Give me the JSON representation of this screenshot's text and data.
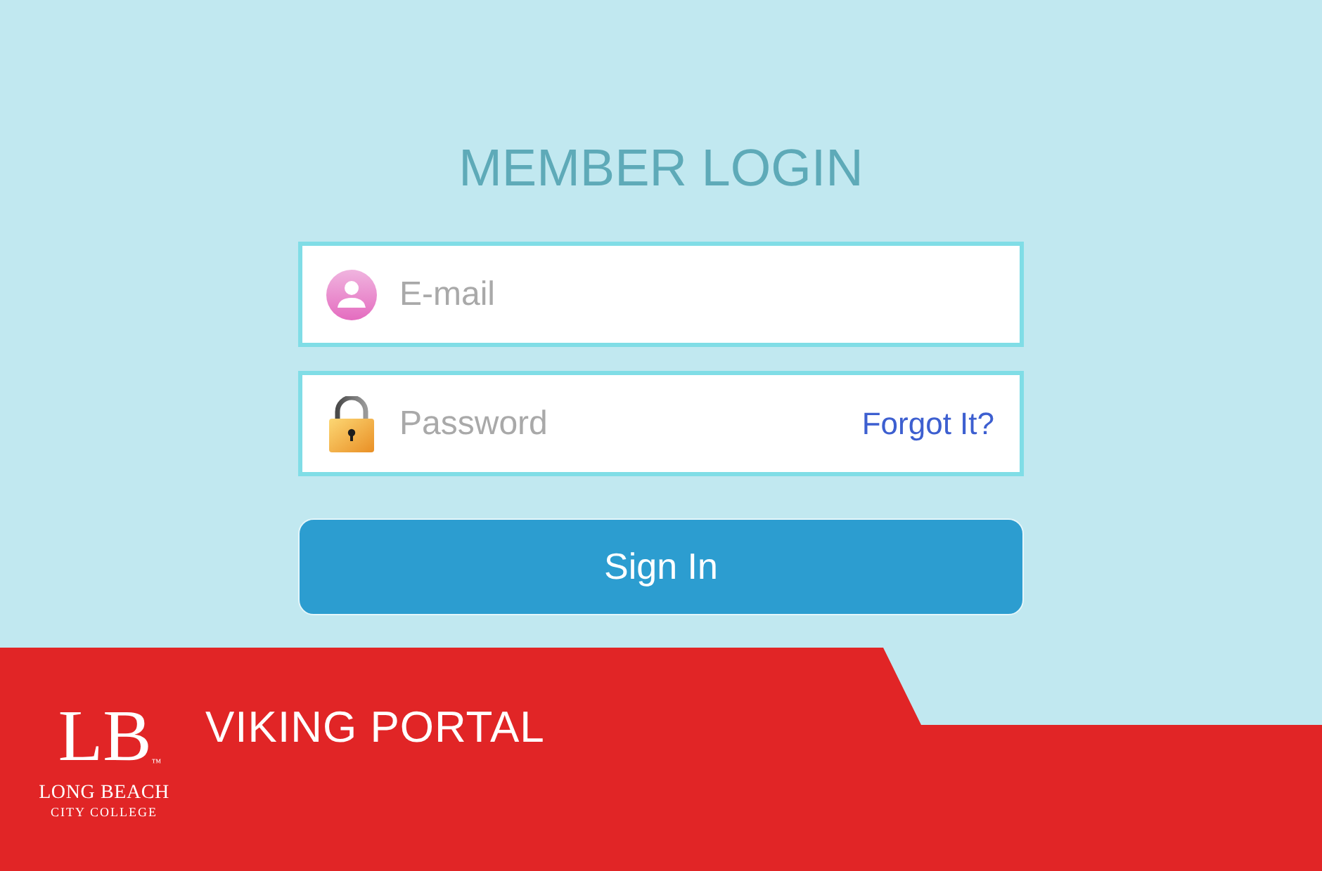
{
  "title": "MEMBER LOGIN",
  "fields": [
    {
      "kind": "email",
      "placeholder": "E-mail"
    },
    {
      "kind": "password",
      "placeholder": "Password",
      "link": "Forgot It?"
    }
  ],
  "button": "Sign In",
  "banner": {
    "logo": {
      "monogram": "LB",
      "trademark": "™",
      "name": "LONG BEACH",
      "subtitle": "CITY COLLEGE"
    },
    "title": "VIKING PORTAL"
  }
}
